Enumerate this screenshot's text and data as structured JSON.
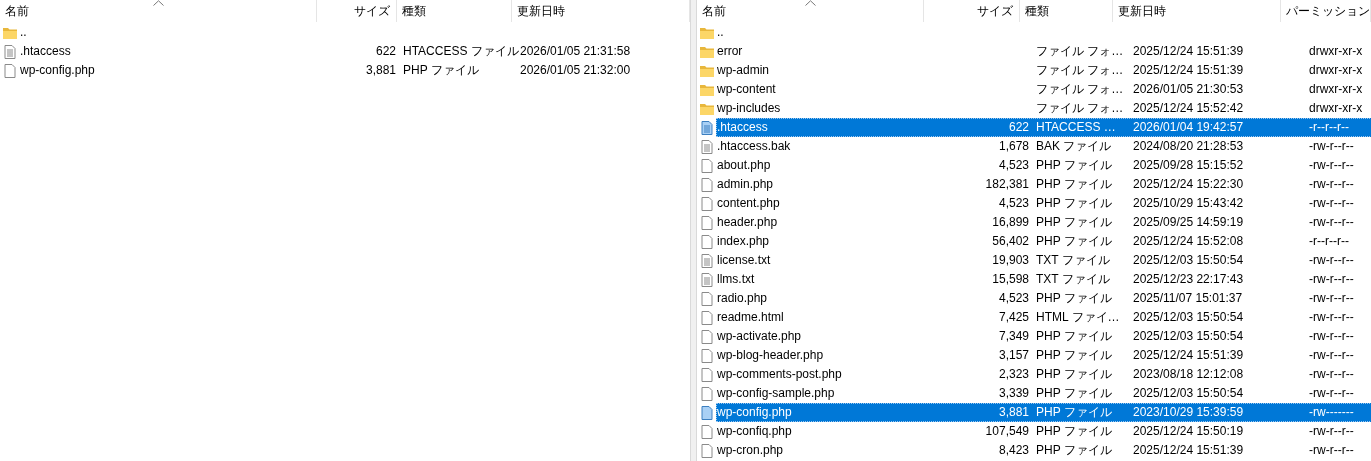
{
  "panels": [
    {
      "columns": [
        {
          "kind": "name",
          "label": "名前",
          "sorted": true
        },
        {
          "kind": "size",
          "label": "サイズ",
          "sorted": false
        },
        {
          "kind": "type",
          "label": "種類",
          "sorted": false
        },
        {
          "kind": "date",
          "label": "更新日時",
          "sorted": false
        }
      ],
      "rows": [
        {
          "kind": "folder",
          "name": "..",
          "selected": false
        },
        {
          "kind": "text",
          "name": ".htaccess",
          "size": "622",
          "type": "HTACCESS ファイル",
          "date": "2026/01/05 21:31:58",
          "selected": false
        },
        {
          "kind": "file",
          "name": "wp-config.php",
          "size": "3,881",
          "type": "PHP ファイル",
          "date": "2026/01/05 21:32:00",
          "selected": false
        }
      ]
    },
    {
      "columns": [
        {
          "kind": "name",
          "label": "名前",
          "sorted": true
        },
        {
          "kind": "size",
          "label": "サイズ",
          "sorted": false
        },
        {
          "kind": "type",
          "label": "種類",
          "sorted": false
        },
        {
          "kind": "date",
          "label": "更新日時",
          "sorted": false
        },
        {
          "kind": "perms",
          "label": "パーミッション",
          "sorted": false
        }
      ],
      "rows": [
        {
          "kind": "folder",
          "name": "..",
          "selected": false
        },
        {
          "kind": "folder",
          "name": "error",
          "type": "ファイル フォ…",
          "date": "2025/12/24 15:51:39",
          "perms": "drwxr-xr-x",
          "selected": false
        },
        {
          "kind": "folder",
          "name": "wp-admin",
          "type": "ファイル フォ…",
          "date": "2025/12/24 15:51:39",
          "perms": "drwxr-xr-x",
          "selected": false
        },
        {
          "kind": "folder",
          "name": "wp-content",
          "type": "ファイル フォ…",
          "date": "2026/01/05 21:30:53",
          "perms": "drwxr-xr-x",
          "selected": false
        },
        {
          "kind": "folder",
          "name": "wp-includes",
          "type": "ファイル フォ…",
          "date": "2025/12/24 15:52:42",
          "perms": "drwxr-xr-x",
          "selected": false
        },
        {
          "kind": "text",
          "name": ".htaccess",
          "size": "622",
          "type": "HTACCESS …",
          "date": "2026/01/04 19:42:57",
          "perms": "-r--r--r--",
          "selected": true
        },
        {
          "kind": "text",
          "name": ".htaccess.bak",
          "size": "1,678",
          "type": "BAK ファイル",
          "date": "2024/08/20 21:28:53",
          "perms": "-rw-r--r--",
          "selected": false
        },
        {
          "kind": "file",
          "name": "about.php",
          "size": "4,523",
          "type": "PHP ファイル",
          "date": "2025/09/28 15:15:52",
          "perms": "-rw-r--r--",
          "selected": false
        },
        {
          "kind": "file",
          "name": "admin.php",
          "size": "182,381",
          "type": "PHP ファイル",
          "date": "2025/12/24 15:22:30",
          "perms": "-rw-r--r--",
          "selected": false
        },
        {
          "kind": "file",
          "name": "content.php",
          "size": "4,523",
          "type": "PHP ファイル",
          "date": "2025/10/29 15:43:42",
          "perms": "-rw-r--r--",
          "selected": false
        },
        {
          "kind": "file",
          "name": "header.php",
          "size": "16,899",
          "type": "PHP ファイル",
          "date": "2025/09/25 14:59:19",
          "perms": "-rw-r--r--",
          "selected": false
        },
        {
          "kind": "file",
          "name": "index.php",
          "size": "56,402",
          "type": "PHP ファイル",
          "date": "2025/12/24 15:52:08",
          "perms": "-r--r--r--",
          "selected": false
        },
        {
          "kind": "text",
          "name": "license.txt",
          "size": "19,903",
          "type": "TXT ファイル",
          "date": "2025/12/03 15:50:54",
          "perms": "-rw-r--r--",
          "selected": false
        },
        {
          "kind": "text",
          "name": "llms.txt",
          "size": "15,598",
          "type": "TXT ファイル",
          "date": "2025/12/23 22:17:43",
          "perms": "-rw-r--r--",
          "selected": false
        },
        {
          "kind": "file",
          "name": "radio.php",
          "size": "4,523",
          "type": "PHP ファイル",
          "date": "2025/11/07 15:01:37",
          "perms": "-rw-r--r--",
          "selected": false
        },
        {
          "kind": "file",
          "name": "readme.html",
          "size": "7,425",
          "type": "HTML ファイ…",
          "date": "2025/12/03 15:50:54",
          "perms": "-rw-r--r--",
          "selected": false
        },
        {
          "kind": "file",
          "name": "wp-activate.php",
          "size": "7,349",
          "type": "PHP ファイル",
          "date": "2025/12/03 15:50:54",
          "perms": "-rw-r--r--",
          "selected": false
        },
        {
          "kind": "file",
          "name": "wp-blog-header.php",
          "size": "3,157",
          "type": "PHP ファイル",
          "date": "2025/12/24 15:51:39",
          "perms": "-rw-r--r--",
          "selected": false
        },
        {
          "kind": "file",
          "name": "wp-comments-post.php",
          "size": "2,323",
          "type": "PHP ファイル",
          "date": "2023/08/18 12:12:08",
          "perms": "-rw-r--r--",
          "selected": false
        },
        {
          "kind": "file",
          "name": "wp-config-sample.php",
          "size": "3,339",
          "type": "PHP ファイル",
          "date": "2025/12/03 15:50:54",
          "perms": "-rw-r--r--",
          "selected": false
        },
        {
          "kind": "file",
          "name": "wp-config.php",
          "size": "3,881",
          "type": "PHP ファイル",
          "date": "2023/10/29 15:39:59",
          "perms": "-rw-------",
          "selected": true
        },
        {
          "kind": "file",
          "name": "wp-confiq.php",
          "size": "107,549",
          "type": "PHP ファイル",
          "date": "2025/12/24 15:50:19",
          "perms": "-rw-r--r--",
          "selected": false
        },
        {
          "kind": "file",
          "name": "wp-cron.php",
          "size": "8,423",
          "type": "PHP ファイル",
          "date": "2025/12/24 15:51:39",
          "perms": "-rw-r--r--",
          "selected": false
        }
      ]
    }
  ]
}
